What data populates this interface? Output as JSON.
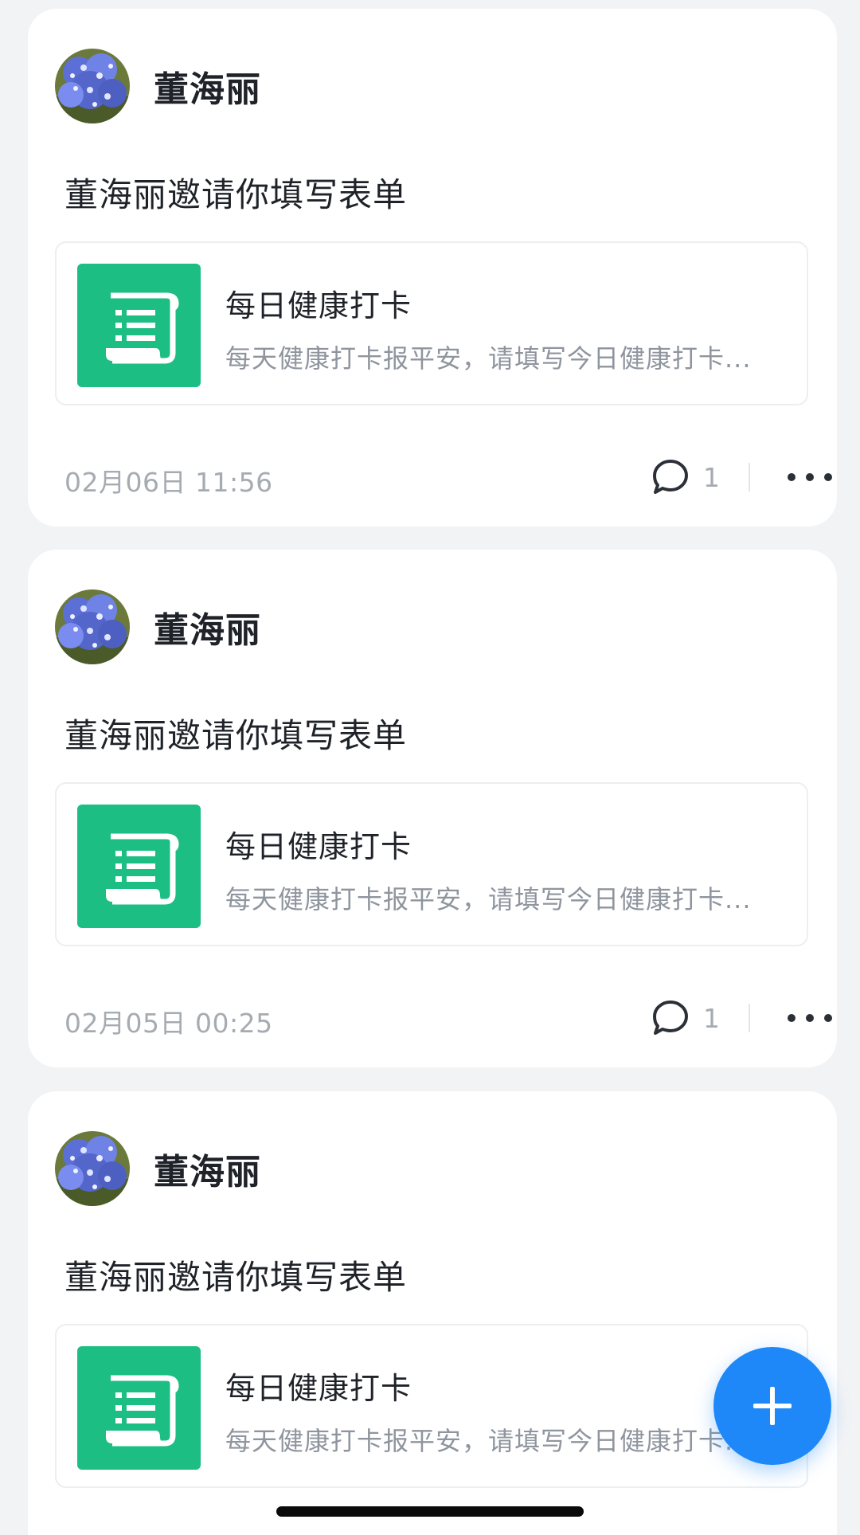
{
  "posts": [
    {
      "author": "董海丽",
      "message": "董海丽邀请你填写表单",
      "form": {
        "title": "每日健康打卡",
        "description": "每天健康打卡报平安，请填写今日健康打卡..."
      },
      "timestamp": "02月06日 11:56",
      "comment_count": "1"
    },
    {
      "author": "董海丽",
      "message": "董海丽邀请你填写表单",
      "form": {
        "title": "每日健康打卡",
        "description": "每天健康打卡报平安，请填写今日健康打卡..."
      },
      "timestamp": "02月05日 00:25",
      "comment_count": "1"
    },
    {
      "author": "董海丽",
      "message": "董海丽邀请你填写表单",
      "form": {
        "title": "每日健康打卡",
        "description": "每天健康打卡报平安，请填写今日健康打卡..."
      }
    }
  ],
  "icons": {
    "avatar": "hydrangea-avatar",
    "form": "scroll-form-icon",
    "comment": "speech-bubble-icon",
    "more": "more-horizontal-icon",
    "fab": "plus-icon"
  },
  "colors": {
    "form_icon_bg": "#1dbe84",
    "fab_bg": "#1e88f8",
    "text_primary": "#1f2329",
    "text_secondary": "#8f959e",
    "background": "#f2f3f5"
  }
}
